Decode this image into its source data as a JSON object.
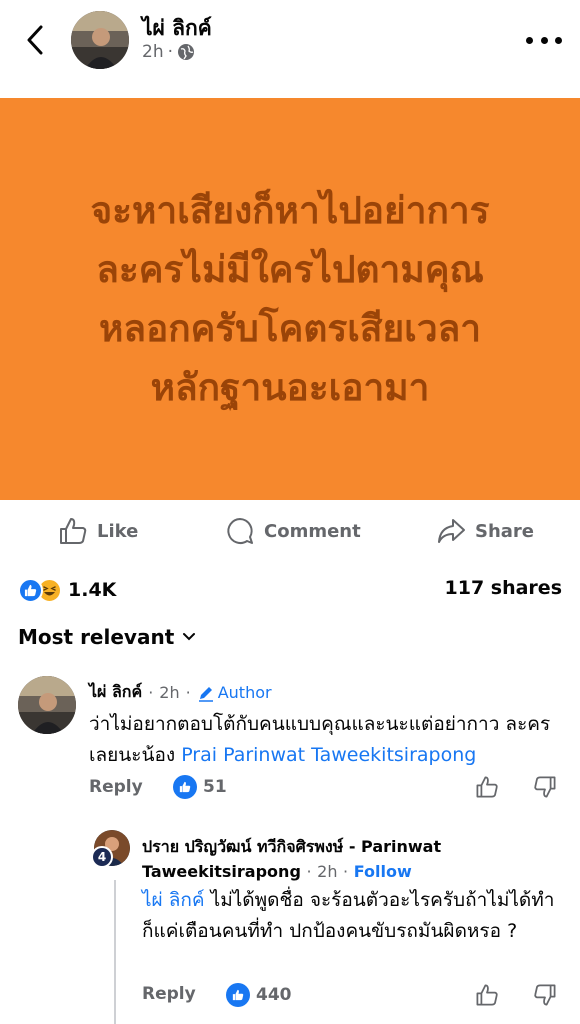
{
  "header": {
    "author": "ไผ่ ลิกค์",
    "time": "2h",
    "separator": "·",
    "privacy_icon": "globe-icon",
    "back_icon": "chevron-left-icon",
    "more_icon": "more-horizontal-icon"
  },
  "post": {
    "background_color": "#f6882d",
    "text_color": "#9a4408",
    "lines": [
      "จะหาเสียงก็หาไปอย่าการ",
      "ละครไม่มีใครไปตามคุณ",
      "หลอกครับโคตรเสียเวลา",
      "หลักฐานอะเอามา"
    ]
  },
  "actions": {
    "like": "Like",
    "comment": "Comment",
    "share": "Share"
  },
  "stats": {
    "reactions_count": "1.4K",
    "shares": "117 shares",
    "reaction_icons": [
      "like-reaction-icon",
      "haha-reaction-icon"
    ]
  },
  "sort": {
    "label": "Most relevant"
  },
  "comment": {
    "author": "ไผ่ ลิกค์",
    "separator": "·",
    "time": "2h",
    "badge": "Author",
    "text": "ว่าไม่อยากตอบโต้กับคนแบบคุณและนะแต่อย่ากาว ละครเลยนะน้อง",
    "mention": "Prai Parinwat Taweekitsirapong",
    "reply_label": "Reply",
    "like_count": "51"
  },
  "reply": {
    "author": "ปราย ปริญวัฒน์ ทวีกิจศิรพงษ์ - Parinwat Taweekitsirapong",
    "separator": "·",
    "time": "2h",
    "follow": "Follow",
    "avatar_badge": "4",
    "mention": "ไผ่ ลิกค์",
    "text": " ไม่ได้พูดชื่อ จะร้อนตัวอะไรครับถ้าไม่ได้ทำ  ก็แค่เตือนคนที่ทำ ปกป้องคนขับรถมันผิดหรอ ?",
    "reply_label": "Reply",
    "like_count": "440"
  }
}
